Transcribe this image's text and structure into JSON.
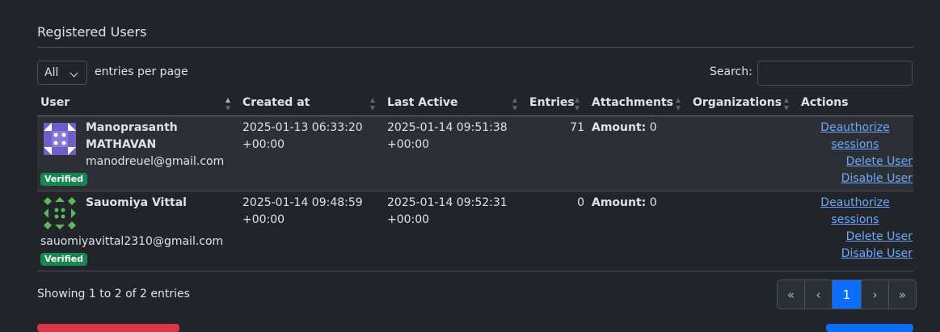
{
  "title": "Registered Users",
  "per_page": {
    "value": "All",
    "label": "entries per page"
  },
  "search": {
    "label": "Search:",
    "value": ""
  },
  "columns": [
    "User",
    "Created at",
    "Last Active",
    "Entries",
    "Attachments",
    "Organizations",
    "Actions"
  ],
  "rows": [
    {
      "name_line1": "Manoprasanth",
      "name_line2": "MATHAVAN",
      "email": "manodreuel@gmail.com",
      "badge": "Verified",
      "created_line1": "2025-01-13 06:33:20",
      "created_line2": "+00:00",
      "active_line1": "2025-01-14 09:51:38",
      "active_line2": "+00:00",
      "entries": "71",
      "attachments_label": "Amount:",
      "attachments_value": "0",
      "actions": {
        "deauth_line1": "Deauthorize",
        "deauth_line2": "sessions",
        "delete": "Delete User",
        "disable": "Disable User"
      }
    },
    {
      "name_line1": "Sauomiya Vittal",
      "email": "sauomiyavittal2310@gmail.com",
      "badge": "Verified",
      "created_line1": "2025-01-14 09:48:59",
      "created_line2": "+00:00",
      "active_line1": "2025-01-14 09:52:31",
      "active_line2": "+00:00",
      "entries": "0",
      "attachments_label": "Amount:",
      "attachments_value": "0",
      "actions": {
        "deauth_line1": "Deauthorize",
        "deauth_line2": "sessions",
        "delete": "Delete User",
        "disable": "Disable User"
      }
    }
  ],
  "footer": "Showing 1 to 2 of 2 entries",
  "pagination": {
    "first": "«",
    "prev": "‹",
    "current": "1",
    "next": "›",
    "last": "»"
  },
  "colors": {
    "background": "#212529",
    "link": "#6ea8fe",
    "badge": "#198754",
    "active_page": "#0d6efd"
  }
}
